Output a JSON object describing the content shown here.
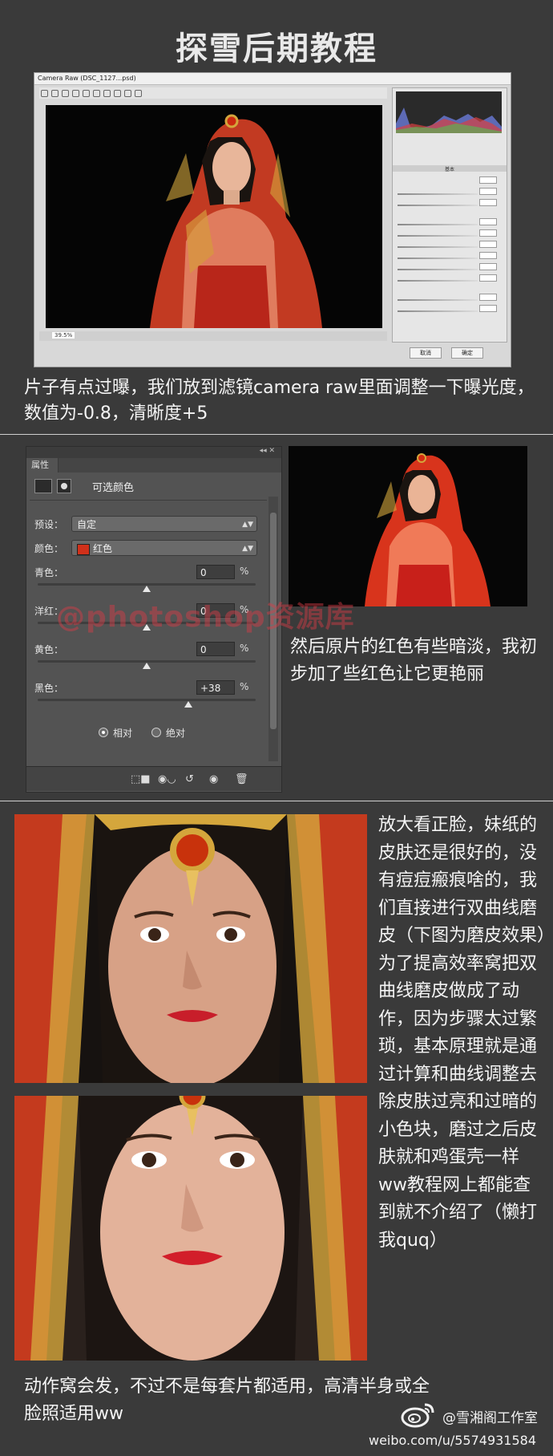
{
  "title": "探雪后期教程",
  "camera_raw": {
    "window_title": "Camera Raw (DSC_1127...psd)",
    "zoom": "39.5%",
    "panel_tab": "基本",
    "cancel_label": "取消",
    "ok_label": "确定"
  },
  "paragraph1": "片子有点过曝，我们放到滤镜camera raw里面调整一下曝光度，数值为-0.8，清晰度+5",
  "properties_panel": {
    "collapse_glyph": "◂◂ ✕",
    "tab_label": "属性",
    "heading": "可选颜色",
    "preset_label": "预设：",
    "preset_value": "自定",
    "colors_label": "颜色：",
    "colors_value": "红色",
    "swatch_color": "#d0301a",
    "sliders": [
      {
        "label": "青色：",
        "value": "0",
        "unit": "%",
        "level": 0
      },
      {
        "label": "洋红：",
        "value": "0",
        "unit": "%",
        "level": 0
      },
      {
        "label": "黄色：",
        "value": "0",
        "unit": "%",
        "level": 0
      },
      {
        "label": "黑色：",
        "value": "+38",
        "unit": "%",
        "level": 38
      }
    ],
    "method_relative": "相对",
    "method_absolute": "绝对"
  },
  "watermark": "@photoshop资源库",
  "paragraph2": "然后原片的红色有些暗淡，我初步加了些红色让它更艳丽",
  "paragraph3": "放大看正脸，妹纸的皮肤还是很好的，没有痘痘瘢痕啥的，我们直接进行双曲线磨皮（下图为磨皮效果）为了提高效率窝把双曲线磨皮做成了动作，因为步骤太过繁琐，基本原理就是通过计算和曲线调整去除皮肤过亮和过暗的小色块，磨过之后皮肤就和鸡蛋壳一样ww教程网上都能查到就不介绍了（懒打我quq）",
  "paragraph4": "动作窝会发，不过不是每套片都适用，高清半身或全脸照适用ww",
  "footer": {
    "handle": "@雪湘阁工作室",
    "url": "weibo.com/u/5574931584"
  },
  "colors": {
    "background": "#3a3a3a",
    "text": "#f4f4f4",
    "accent_red": "#d0301a"
  }
}
